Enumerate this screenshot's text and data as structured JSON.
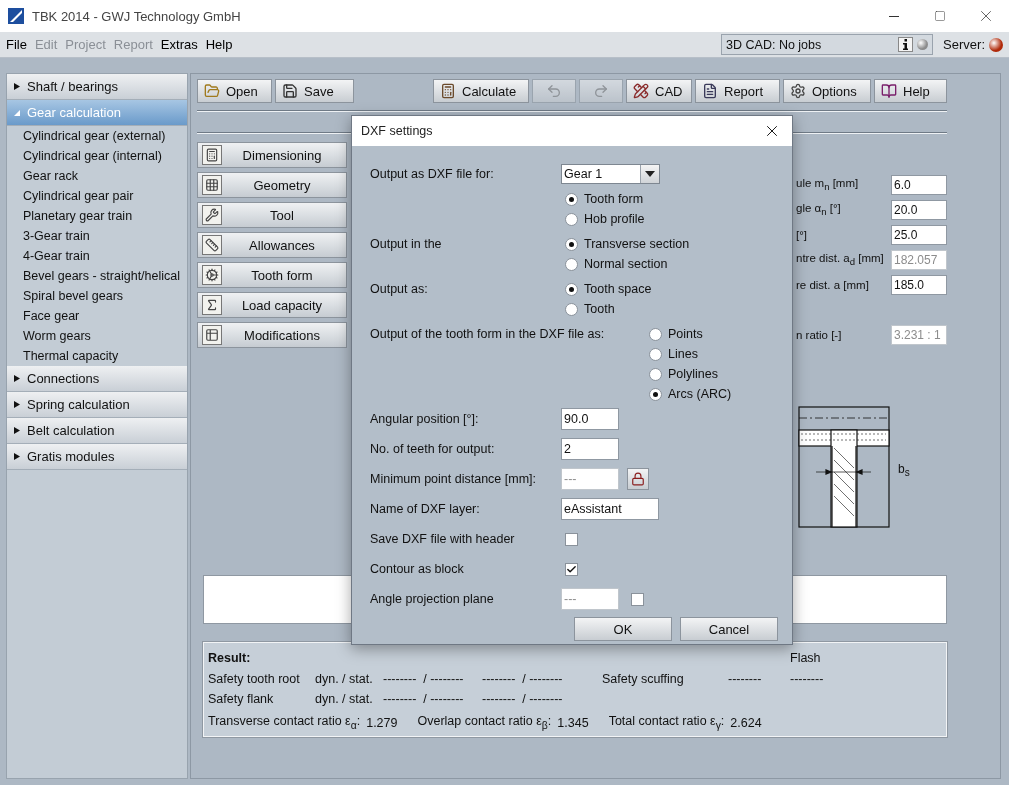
{
  "window": {
    "title": "TBK 2014 - GWJ Technology GmbH"
  },
  "menu": [
    {
      "label": "File",
      "disabled": false
    },
    {
      "label": "Edit",
      "disabled": true
    },
    {
      "label": "Project",
      "disabled": true
    },
    {
      "label": "Report",
      "disabled": true
    },
    {
      "label": "Extras",
      "disabled": false
    },
    {
      "label": "Help",
      "disabled": false
    }
  ],
  "cad_status": {
    "text": "3D CAD: No jobs"
  },
  "server": {
    "label": "Server:"
  },
  "sidebar": [
    {
      "label": "Shaft / bearings",
      "expanded": false,
      "selected": false
    },
    {
      "label": "Gear calculation",
      "expanded": true,
      "selected": true,
      "children": [
        {
          "label": "Cylindrical gear (external)"
        },
        {
          "label": "Cylindrical gear (internal)"
        },
        {
          "label": "Gear rack"
        },
        {
          "label": "Cylindrical gear pair"
        },
        {
          "label": "Planetary gear train"
        },
        {
          "label": "3-Gear train"
        },
        {
          "label": "4-Gear train"
        },
        {
          "label": "Bevel gears - straight/helical"
        },
        {
          "label": "Spiral bevel gears"
        },
        {
          "label": "Face gear"
        },
        {
          "label": "Worm gears"
        },
        {
          "label": "Thermal capacity"
        }
      ]
    },
    {
      "label": "Connections",
      "expanded": false,
      "selected": false
    },
    {
      "label": "Spring calculation",
      "expanded": false,
      "selected": false
    },
    {
      "label": "Belt calculation",
      "expanded": false,
      "selected": false
    },
    {
      "label": "Gratis modules",
      "expanded": false,
      "selected": false
    }
  ],
  "toolbar": {
    "left": [
      {
        "kind": "open",
        "label": "Open",
        "disabled": false
      },
      {
        "kind": "save",
        "label": "Save",
        "disabled": false
      }
    ],
    "right": [
      {
        "kind": "calculate",
        "label": "Calculate",
        "disabled": false
      },
      {
        "kind": "undo",
        "disabled": true
      },
      {
        "kind": "redo",
        "disabled": true
      },
      {
        "kind": "cad",
        "label": "CAD",
        "disabled": false
      },
      {
        "kind": "report",
        "label": "Report",
        "disabled": false
      },
      {
        "kind": "options",
        "label": "Options",
        "disabled": false
      },
      {
        "kind": "help",
        "label": "Help",
        "disabled": false
      }
    ]
  },
  "modules": [
    {
      "kind": "dimensioning",
      "label": "Dimensioning"
    },
    {
      "kind": "geometry",
      "label": "Geometry"
    },
    {
      "kind": "tool",
      "label": "Tool"
    },
    {
      "kind": "allowances",
      "label": "Allowances"
    },
    {
      "kind": "tooth_form",
      "label": "Tooth form"
    },
    {
      "kind": "load",
      "label": "Load capacity"
    },
    {
      "kind": "modifications",
      "label": "Modifications"
    }
  ],
  "parameters": [
    {
      "label": "ule m$_{n}$ [mm]",
      "value": "6.0",
      "disabled": false
    },
    {
      "label": "gle α$_{n}$ [°]",
      "value": "20.0",
      "disabled": false
    },
    {
      "label": "[°]",
      "value": "25.0",
      "disabled": false
    },
    {
      "label": "ntre dist. a$_{d}$ [mm]",
      "value": "182.057",
      "disabled": true
    },
    {
      "label": "re dist. a [mm]",
      "value": "185.0",
      "disabled": false
    },
    {
      "label": "n ratio [-]",
      "value": "3.231 : 1",
      "disabled": true
    }
  ],
  "drawing": {
    "label": "b$_{s}$"
  },
  "results": {
    "title": "Result:",
    "flash_header": "Flash",
    "rows": [
      {
        "label": "Safety tooth root",
        "mode": "dyn. / stat.",
        "value_1": "--------  / --------",
        "value_2": "--------  / --------",
        "extra_label": "Safety scuffing",
        "extra_1": "--------",
        "extra_2": "--------"
      },
      {
        "label": "Safety flank",
        "mode": "dyn. / stat.",
        "value_1": "--------  / --------",
        "value_2": "--------  / --------"
      }
    ],
    "contact_ratios": [
      {
        "label": "Transverse contact ratio ε$_{α}$:",
        "value": "1.279"
      },
      {
        "label": "Overlap contact ratio ε$_{β}$:",
        "value": "1.345"
      },
      {
        "label": "Total contact ratio ε$_{γ}$:",
        "value": "2.624"
      }
    ]
  },
  "dialog": {
    "title": "DXF settings",
    "rows": [
      {
        "kind": "select",
        "label": "Output as DXF file for:",
        "value": "Gear 1"
      },
      {
        "kind": "radio",
        "options": [
          {
            "label": "Tooth form",
            "selected": true
          },
          {
            "label": "Hob profile",
            "selected": false
          }
        ]
      },
      {
        "kind": "radio",
        "label": "Output in the",
        "options": [
          {
            "label": "Transverse section",
            "selected": true
          },
          {
            "label": "Normal section",
            "selected": false
          }
        ]
      },
      {
        "kind": "radio",
        "label": "Output as:",
        "options": [
          {
            "label": "Tooth space",
            "selected": true
          },
          {
            "label": "Tooth",
            "selected": false
          }
        ]
      },
      {
        "kind": "radio-wide",
        "label": "Output of the tooth form in the DXF file as:",
        "options": [
          {
            "label": "Points",
            "selected": false
          },
          {
            "label": "Lines",
            "selected": false
          },
          {
            "label": "Polylines",
            "selected": false
          },
          {
            "label": "Arcs (ARC)",
            "selected": true
          }
        ]
      },
      {
        "kind": "input",
        "label": "Angular position [°]:",
        "value": "90.0",
        "disabled": false
      },
      {
        "kind": "input",
        "label": "No. of teeth for output:",
        "value": "2",
        "disabled": false
      },
      {
        "kind": "input-lock",
        "label": "Minimum point distance [mm]:",
        "value": "---",
        "disabled": true
      },
      {
        "kind": "text",
        "label": "Name of DXF layer:",
        "value": "eAssistant",
        "disabled": false
      },
      {
        "kind": "checkbox",
        "label": "Save DXF file with header",
        "checked": false
      },
      {
        "kind": "checkbox",
        "label": "Contour as block",
        "checked": true
      },
      {
        "kind": "input-check",
        "label": "Angle projection plane",
        "value": "---",
        "disabled": true,
        "checked": false
      }
    ],
    "buttons": [
      "OK",
      "Cancel"
    ]
  }
}
